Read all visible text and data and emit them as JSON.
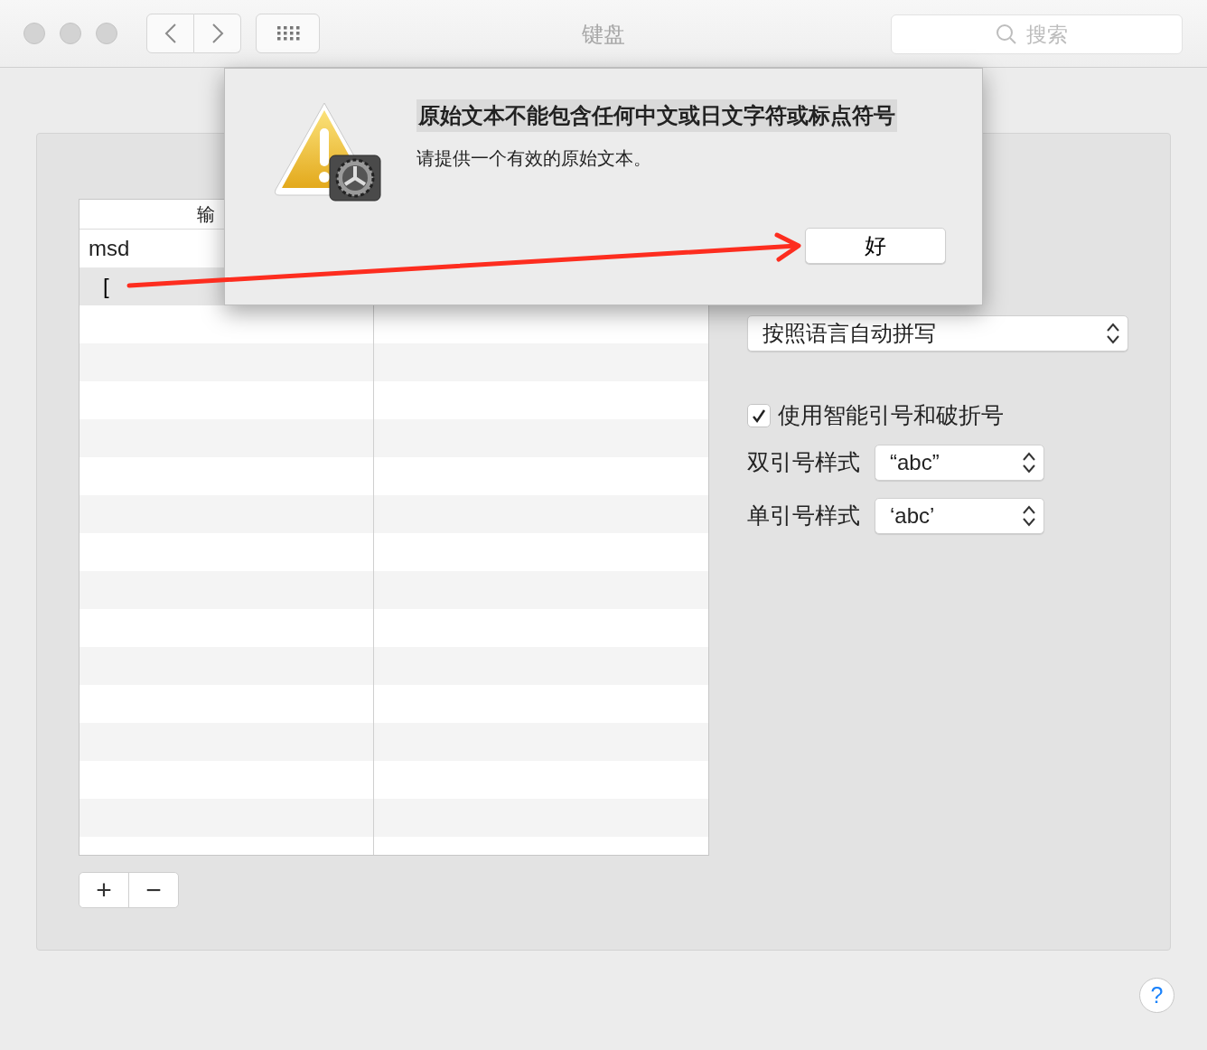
{
  "window": {
    "title": "键盘",
    "search": {
      "placeholder": "搜索"
    }
  },
  "table": {
    "columns": [
      "输"
    ],
    "rows": [
      {
        "text": "msd",
        "selected": false,
        "editing": false
      },
      {
        "text": "[",
        "selected": true,
        "editing": true
      }
    ]
  },
  "spelling_popup": {
    "value": "按照语言自动拼写"
  },
  "smart_quotes": {
    "label": "使用智能引号和破折号",
    "checked": true
  },
  "quote_styles": [
    {
      "label": "双引号样式",
      "value": "“abc”"
    },
    {
      "label": "单引号样式",
      "value": "‘abc’"
    }
  ],
  "list_buttons": [
    "+",
    "−"
  ],
  "help_button": "?",
  "alert": {
    "title": "原始文本不能包含任何中文或日文字符或标点符号",
    "message": "请提供一个有效的原始文本。",
    "button": "好"
  }
}
